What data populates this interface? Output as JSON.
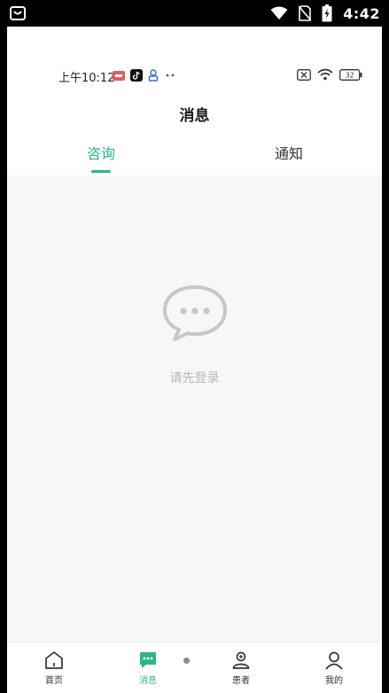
{
  "system_status": {
    "time": "4:42",
    "app_icon": "bag-icon",
    "icons": [
      "wifi-icon",
      "no-sim-icon",
      "battery-icon"
    ]
  },
  "inner_status": {
    "time": "上午10:12",
    "badges": [
      "message-badge-icon",
      "tiktok-icon",
      "app-notification-icon",
      "more-dots-icon"
    ],
    "right_icons": [
      "sim-x-icon",
      "wifi-icon",
      "battery-icon"
    ],
    "battery": "32"
  },
  "page": {
    "title": "消息"
  },
  "tabs": [
    {
      "label": "咨询",
      "active": true
    },
    {
      "label": "通知",
      "active": false
    }
  ],
  "empty_state": {
    "icon": "chat-bubble-icon",
    "text": "请先登录"
  },
  "bottom_nav": [
    {
      "label": "首页",
      "icon": "home-icon",
      "active": false
    },
    {
      "label": "消息",
      "icon": "message-icon",
      "active": true
    },
    {
      "label": "患者",
      "icon": "patient-icon",
      "active": false
    },
    {
      "label": "我的",
      "icon": "profile-icon",
      "active": false
    }
  ],
  "colors": {
    "accent": "#2fb48a",
    "background": "#f7f7f9",
    "empty_text": "#b8b8b8"
  }
}
